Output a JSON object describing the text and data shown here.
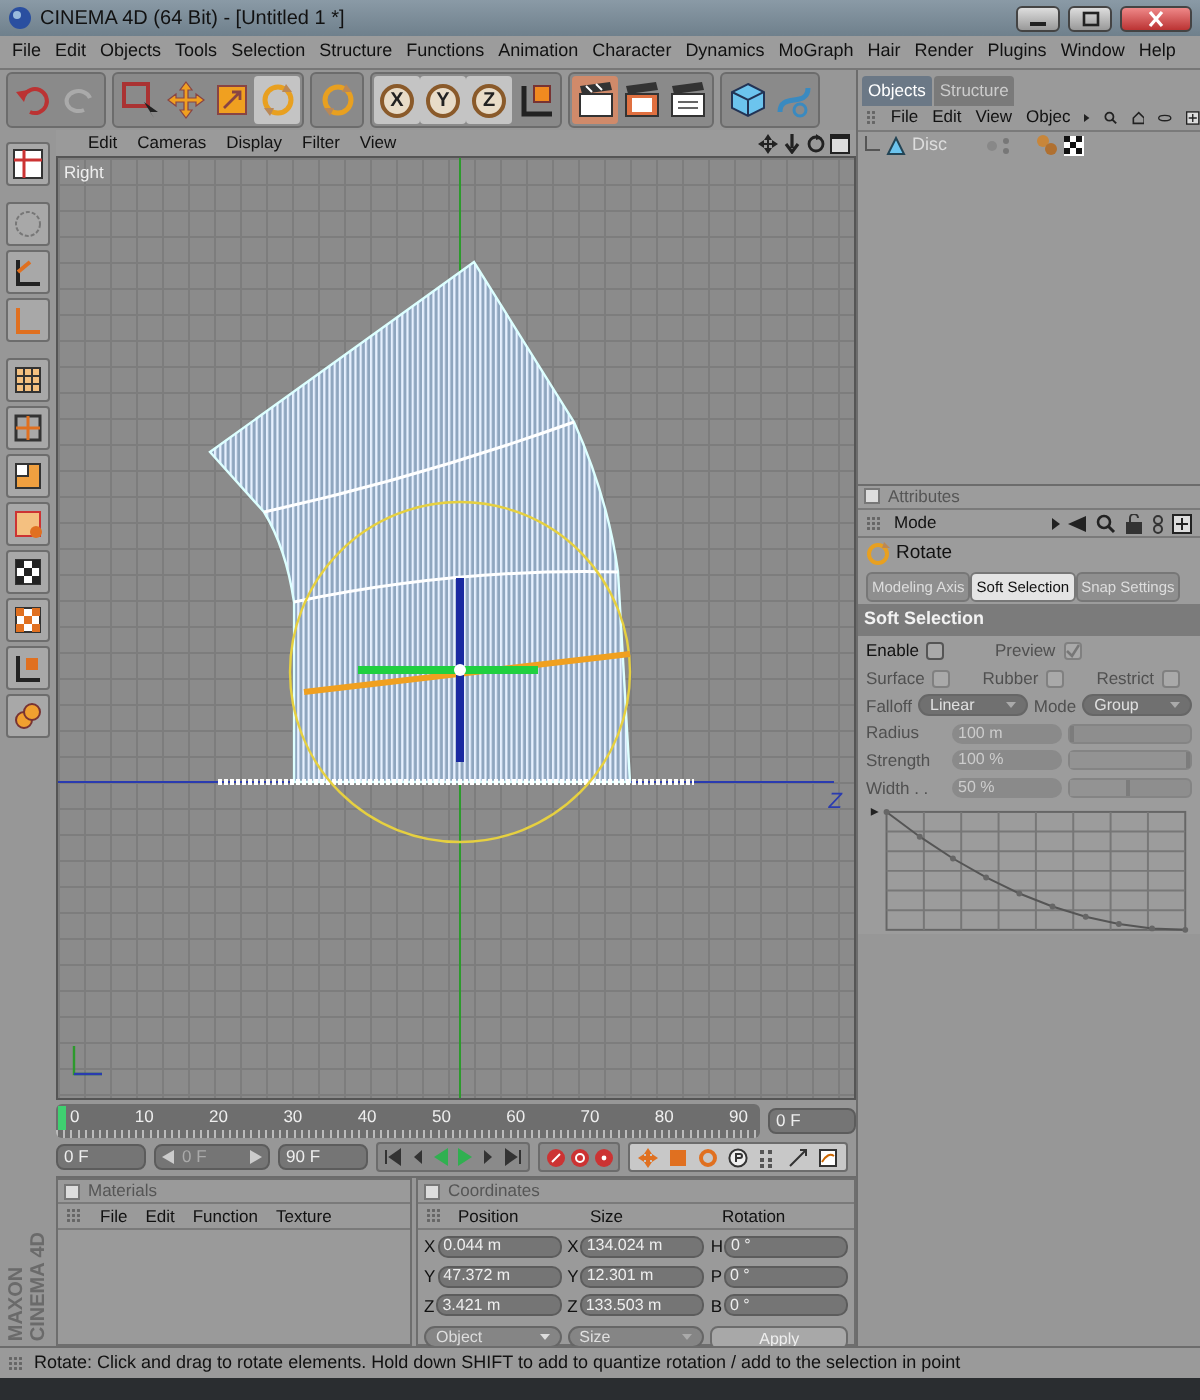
{
  "window": {
    "title": "CINEMA 4D (64 Bit) - [Untitled 1 *]"
  },
  "menu": [
    "File",
    "Edit",
    "Objects",
    "Tools",
    "Selection",
    "Structure",
    "Functions",
    "Animation",
    "Character",
    "Dynamics",
    "MoGraph",
    "Hair",
    "Render",
    "Plugins",
    "Window",
    "Help"
  ],
  "toolbar": [
    [
      {
        "active": false
      },
      {
        "active": false
      }
    ],
    [
      {
        "active": false
      },
      {
        "active": false
      },
      {
        "active": false
      },
      {
        "active": true
      }
    ],
    [
      {
        "active": false
      }
    ],
    [
      {
        "active": true,
        "label": "X"
      },
      {
        "active": true,
        "label": "Y"
      },
      {
        "active": true,
        "label": "Z"
      },
      {
        "active": false
      }
    ],
    [
      {
        "active": true
      },
      {
        "active": false
      },
      {
        "active": false
      }
    ],
    [
      {
        "active": false
      },
      {
        "active": false
      }
    ]
  ],
  "viewport": {
    "menu": [
      "Edit",
      "Cameras",
      "Display",
      "Filter",
      "View"
    ],
    "camera": "Right",
    "axis_label": "Z"
  },
  "timeline": {
    "ticks": [
      "0",
      "10",
      "20",
      "30",
      "40",
      "50",
      "60",
      "70",
      "80",
      "90"
    ],
    "level": 0,
    "current_frame": "0 F",
    "start": "0 F",
    "preview": "0 F",
    "end": "90 F"
  },
  "materials": {
    "title": "Materials",
    "checked": false,
    "menu": [
      "File",
      "Edit",
      "Function",
      "Texture"
    ]
  },
  "coordinates": {
    "title": "Coordinates",
    "checked": false,
    "columns": [
      "Position",
      "Size",
      "Rotation"
    ],
    "rows": [
      [
        {
          "axis": "X",
          "value": "0.044 m"
        },
        {
          "axis": "X",
          "value": "134.024 m"
        },
        {
          "axis": "H",
          "value": "0 °"
        }
      ],
      [
        {
          "axis": "Y",
          "value": "47.372 m"
        },
        {
          "axis": "Y",
          "value": "12.301 m"
        },
        {
          "axis": "P",
          "value": "0 °"
        }
      ],
      [
        {
          "axis": "Z",
          "value": "3.421 m"
        },
        {
          "axis": "Z",
          "value": "133.503 m"
        },
        {
          "axis": "B",
          "value": "0 °"
        }
      ]
    ],
    "mode": "Object",
    "size_mode": "Size",
    "apply": "Apply"
  },
  "objects": {
    "tabs": [
      {
        "label": "Objects",
        "selected": true
      },
      {
        "label": "Structure",
        "selected": false
      }
    ],
    "menu": [
      "File",
      "Edit",
      "View",
      "Objec"
    ],
    "items": [
      {
        "name": "Disc"
      }
    ]
  },
  "attributes": {
    "title": "Attributes",
    "checked": false,
    "mode": "Mode",
    "tool": "Rotate",
    "tabs": [
      {
        "label": "Modeling Axis",
        "selected": false
      },
      {
        "label": "Soft Selection",
        "selected": true
      },
      {
        "label": "Snap Settings",
        "selected": false
      }
    ],
    "section": "Soft Selection",
    "checks": [
      [
        {
          "label": "Enable",
          "checked": false,
          "disabled": false
        },
        {
          "label": "Preview",
          "checked": true,
          "disabled": true
        }
      ],
      [
        {
          "label": "Surface",
          "checked": false,
          "disabled": true
        },
        {
          "label": "Rubber",
          "checked": false,
          "disabled": true
        },
        {
          "label": "Restrict",
          "checked": false,
          "disabled": true
        }
      ]
    ],
    "selects": [
      {
        "label": "Falloff",
        "value": "Linear",
        "disabled": true
      },
      {
        "label": "Mode",
        "value": "Group",
        "disabled": true
      }
    ],
    "sliders": [
      {
        "label": "Radius",
        "value": "100 m",
        "level": 0.03,
        "disabled": true
      },
      {
        "label": "Strength",
        "value": "100 %",
        "level": 1,
        "disabled": true
      },
      {
        "label": "Width . .",
        "value": "50 %",
        "level": 0.5,
        "disabled": true
      }
    ]
  },
  "status_bar": "Rotate: Click and drag to rotate elements. Hold down SHIFT to add to quantize rotation / add to the selection in point",
  "logo": [
    "MAXON",
    "CINEMA 4D"
  ]
}
